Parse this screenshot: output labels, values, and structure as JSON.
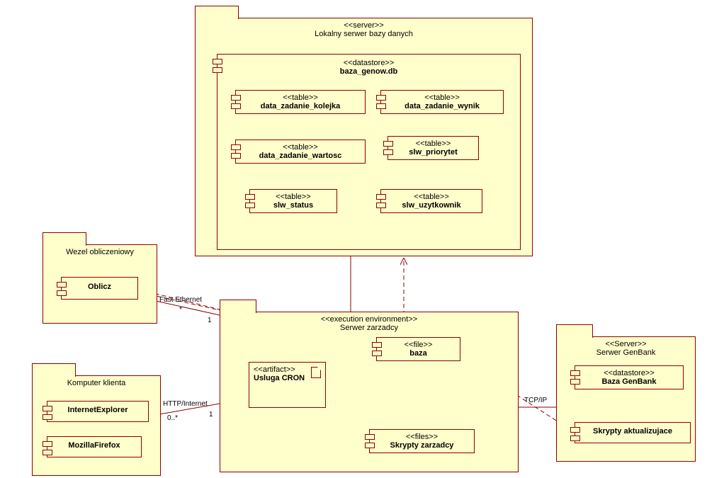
{
  "packages": {
    "dbserver": {
      "stereotype": "<<server>>",
      "title": "Lokalny serwer bazy danych"
    },
    "datastore": {
      "stereotype": "<<datastore>>",
      "title": "baza_genow.db"
    },
    "compute": {
      "title": "Wezel obliczeniowy"
    },
    "client": {
      "title": "Komputer klienta"
    },
    "execenv": {
      "stereotype": "<<execution environment>>",
      "title": "Serwer zarzadcy"
    },
    "genbank": {
      "stereotype": "<<Server>>",
      "title": "Serwer GenBank"
    }
  },
  "components": {
    "t1": {
      "stereotype": "<<table>>",
      "name": "data_zadanie_kolejka"
    },
    "t2": {
      "stereotype": "<<table>>",
      "name": "data_zadanie_wynik"
    },
    "t3": {
      "stereotype": "<<table>>",
      "name": "data_zadanie_wartosc"
    },
    "t4": {
      "stereotype": "<<table>>",
      "name": "slw_priorytet"
    },
    "t5": {
      "stereotype": "<<table>>",
      "name": "slw_status"
    },
    "t6": {
      "stereotype": "<<table>>",
      "name": "slw_uzytkownik"
    },
    "oblicz": {
      "name": "Oblicz"
    },
    "ie": {
      "name": "InternetExplorer"
    },
    "ff": {
      "name": "MozillaFirefox"
    },
    "baza": {
      "stereotype": "<<file>>",
      "name": "baza"
    },
    "scripts": {
      "stereotype": "<<files>>",
      "name": "Skrypty zarzadcy"
    },
    "gbstore": {
      "stereotype": "<<datastore>>",
      "name": "Baza GenBank"
    },
    "gbscripts": {
      "name": "Skrypty aktualizujace"
    }
  },
  "artifacts": {
    "cron": {
      "stereotype": "<<artifact>>",
      "name": "Usluga CRON"
    }
  },
  "labels": {
    "fastEthernet": "Fast Ethernet",
    "httpInternet": "HTTP/Internet",
    "tcpip": "TCP/IP",
    "one": "1",
    "star": "*",
    "zeroStar": "0..*"
  }
}
